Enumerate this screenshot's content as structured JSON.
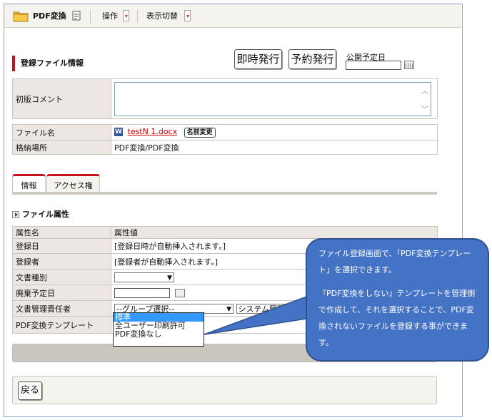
{
  "toolbar": {
    "title": "PDF変換",
    "operation_label": "操作",
    "view_switch_label": "表示切替"
  },
  "actions": {
    "immediate_publish_label": "即時発行",
    "scheduled_publish_label": "予約発行",
    "publish_date_label": "公開予定日",
    "publish_date_value": ""
  },
  "section": {
    "title": "登録ファイル情報"
  },
  "file_info": {
    "initial_comment_label": "初版コメント",
    "initial_comment_value": "",
    "file_name_label": "ファイル名",
    "file_name_value": "testN 1.docx",
    "rename_button_label": "名前変更",
    "storage_location_label": "格納場所",
    "storage_location_value": "PDF変換/PDF変換"
  },
  "tabs": [
    {
      "label": "情報"
    },
    {
      "label": "アクセス権"
    }
  ],
  "attributes": {
    "group_title": "ファイル属性",
    "col_name": "属性名",
    "col_value": "属性値",
    "rows": [
      {
        "name": "登録日",
        "value": "[登録日時が自動挿入されます。]"
      },
      {
        "name": "登録者",
        "value": "[登録者が自動挿入されます。]"
      },
      {
        "name": "文書種別",
        "value": ""
      },
      {
        "name": "廃棄予定日",
        "value": ""
      },
      {
        "name": "文書管理責任者",
        "value": "--グループ選択--",
        "extra": "システム管理者"
      },
      {
        "name": "PDF変換テンプレート",
        "value": ""
      }
    ]
  },
  "template_options": [
    "標準",
    "全ユーザー印刷許可",
    "PDF変換なし"
  ],
  "template_selected": "標準",
  "back_button_label": "戻る",
  "callout": {
    "line1": "ファイル登録画面で、「PDF変換テンプレート」を選択できます。",
    "line2": "『PDF変換をしない』テンプレートを管理側で作成して、それを選択することで、PDF変換されないファイルを登録する事ができます。"
  },
  "colors": {
    "accent_red": "#c8141e",
    "callout_blue": "#4472c4",
    "header_bg": "#ede7e3",
    "listbox_highlight": "#3399ff"
  },
  "icons": [
    "folder-icon",
    "document-icon",
    "dropdown-icon",
    "calendar-icon",
    "word-file-icon",
    "triangle-right-icon"
  ]
}
